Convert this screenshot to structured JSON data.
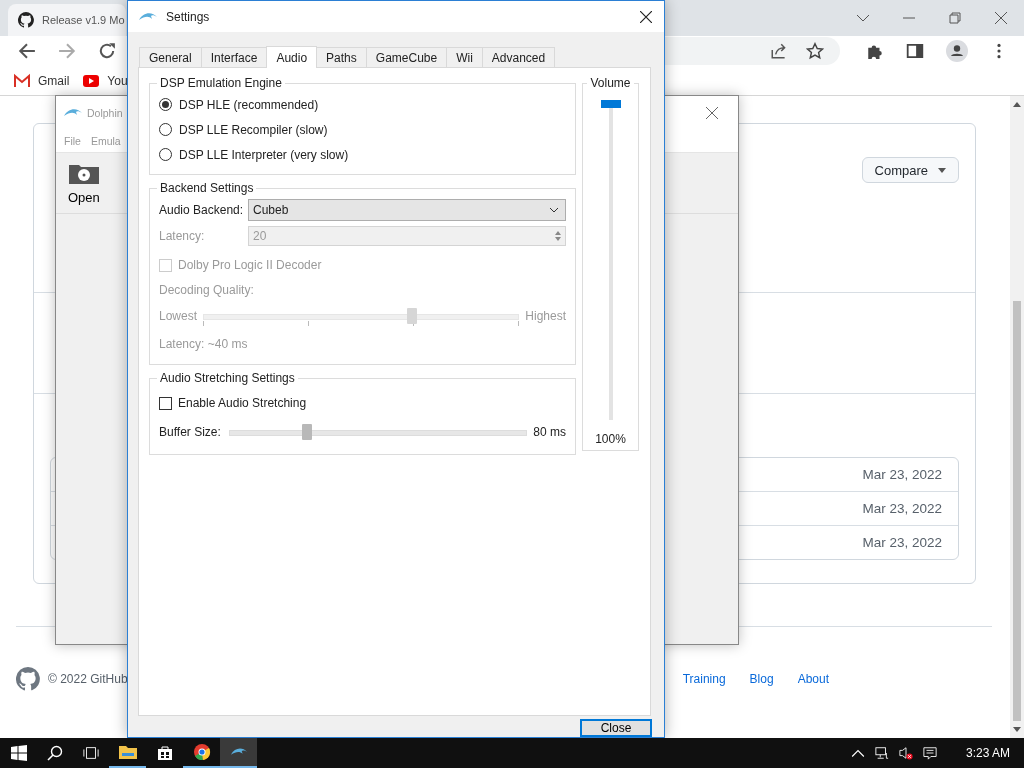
{
  "browser": {
    "tab_title": "Release v1.9 Mo",
    "bookmarks": [
      "Gmail",
      "You"
    ],
    "compare_button": "Compare",
    "release_dates": [
      "Mar 23, 2022",
      "Mar 23, 2022",
      "Mar 23, 2022"
    ],
    "footer": {
      "copyright": "© 2022 GitHub",
      "links": [
        "Training",
        "Blog",
        "About"
      ]
    }
  },
  "dolphin_window": {
    "title": "Dolphin",
    "menu": [
      "File",
      "Emula"
    ],
    "toolbar": [
      "Open"
    ]
  },
  "settings": {
    "title": "Settings",
    "tabs": [
      {
        "label": "General",
        "selected": false
      },
      {
        "label": "Interface",
        "selected": false
      },
      {
        "label": "Audio",
        "selected": true
      },
      {
        "label": "Paths",
        "selected": false
      },
      {
        "label": "GameCube",
        "selected": false
      },
      {
        "label": "Wii",
        "selected": false
      },
      {
        "label": "Advanced",
        "selected": false
      }
    ],
    "dsp": {
      "title": "DSP Emulation Engine",
      "options": [
        {
          "label": "DSP HLE (recommended)",
          "selected": true
        },
        {
          "label": "DSP LLE Recompiler (slow)",
          "selected": false
        },
        {
          "label": "DSP LLE Interpreter (very slow)",
          "selected": false
        }
      ]
    },
    "backend": {
      "title": "Backend Settings",
      "audio_backend_label": "Audio Backend:",
      "audio_backend": "Cubeb",
      "latency": {
        "label": "Latency:",
        "value": "20",
        "disabled": true
      },
      "dolby": {
        "label": "Dolby Pro Logic II Decoder",
        "checked": false,
        "disabled": true
      },
      "quality": {
        "label": "Decoding Quality:",
        "min": "Lowest",
        "max": "Highest",
        "level": 0.66,
        "disabled": true
      },
      "latency_note": "Latency: ~40 ms"
    },
    "stretching": {
      "title": "Audio Stretching Settings",
      "enable": {
        "label": "Enable Audio Stretching",
        "checked": false
      },
      "buffer": {
        "label": "Buffer Size:",
        "level": 0.26,
        "reading": "80 ms"
      }
    },
    "volume": {
      "title": "Volume",
      "level": 1.0,
      "reading": "100%"
    },
    "close_button": "Close"
  },
  "taskbar": {
    "time": "3:23 AM"
  }
}
